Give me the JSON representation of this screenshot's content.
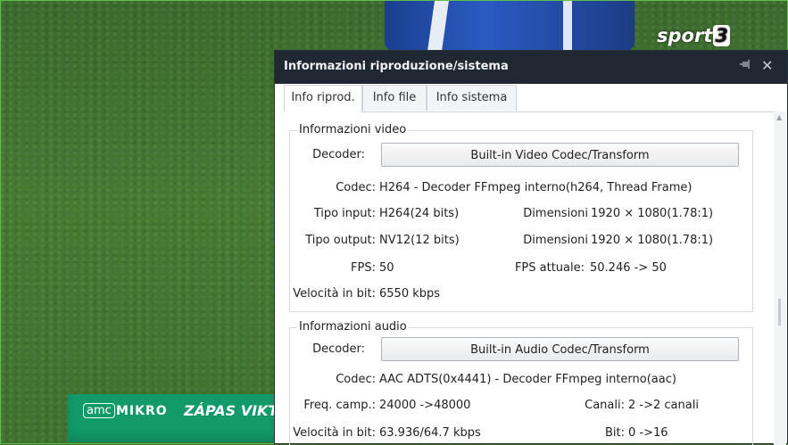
{
  "video": {
    "channel_logo": "sport",
    "channel_logo_num": "3",
    "ticker": {
      "badge": "amc",
      "brand": "MIKRO",
      "headline": "ZÁPAS VIKT"
    }
  },
  "dialog": {
    "title": "Informazioni riproduzione/sistema",
    "pin_icon": "pin-icon",
    "close_icon": "close-icon",
    "tabs": [
      {
        "label": "Info riprod.",
        "active": true
      },
      {
        "label": "Info file",
        "active": false
      },
      {
        "label": "Info sistema",
        "active": false
      }
    ],
    "video_info": {
      "legend": "Informazioni video",
      "decoder_label": "Decoder:",
      "decoder_value": "Built-in Video Codec/Transform",
      "codec_label": "Codec:",
      "codec_value": "H264 - Decoder FFmpeg interno(h264, Thread Frame)",
      "input_label": "Tipo input:",
      "input_value": "H264(24 bits)",
      "input_dim_label": "Dimensioni",
      "input_dim_value": "1920 × 1080(1.78:1)",
      "output_label": "Tipo output:",
      "output_value": "NV12(12 bits)",
      "output_dim_label": "Dimensioni",
      "output_dim_value": "1920 × 1080(1.78:1)",
      "fps_label": "FPS:",
      "fps_value": "50",
      "fps_actual_label": "FPS attuale:",
      "fps_actual_value": "50.246 -> 50",
      "bitrate_label": "Velocità in bit:",
      "bitrate_value": "6550 kbps"
    },
    "audio_info": {
      "legend": "Informazioni audio",
      "decoder_label": "Decoder:",
      "decoder_value": "Built-in Audio Codec/Transform",
      "codec_label": "Codec:",
      "codec_value": "AAC ADTS(0x4441) - Decoder FFmpeg interno(aac)",
      "freq_label": "Freq. camp.:",
      "freq_value": "24000 ->48000",
      "channels_label": "Canali:",
      "channels_value": "2 ->2 canali",
      "bitrate_label": "Velocità in bit:",
      "bitrate_value": "63.936/64.7 kbps",
      "bits_label": "Bit:",
      "bits_value": "0 ->16"
    }
  }
}
